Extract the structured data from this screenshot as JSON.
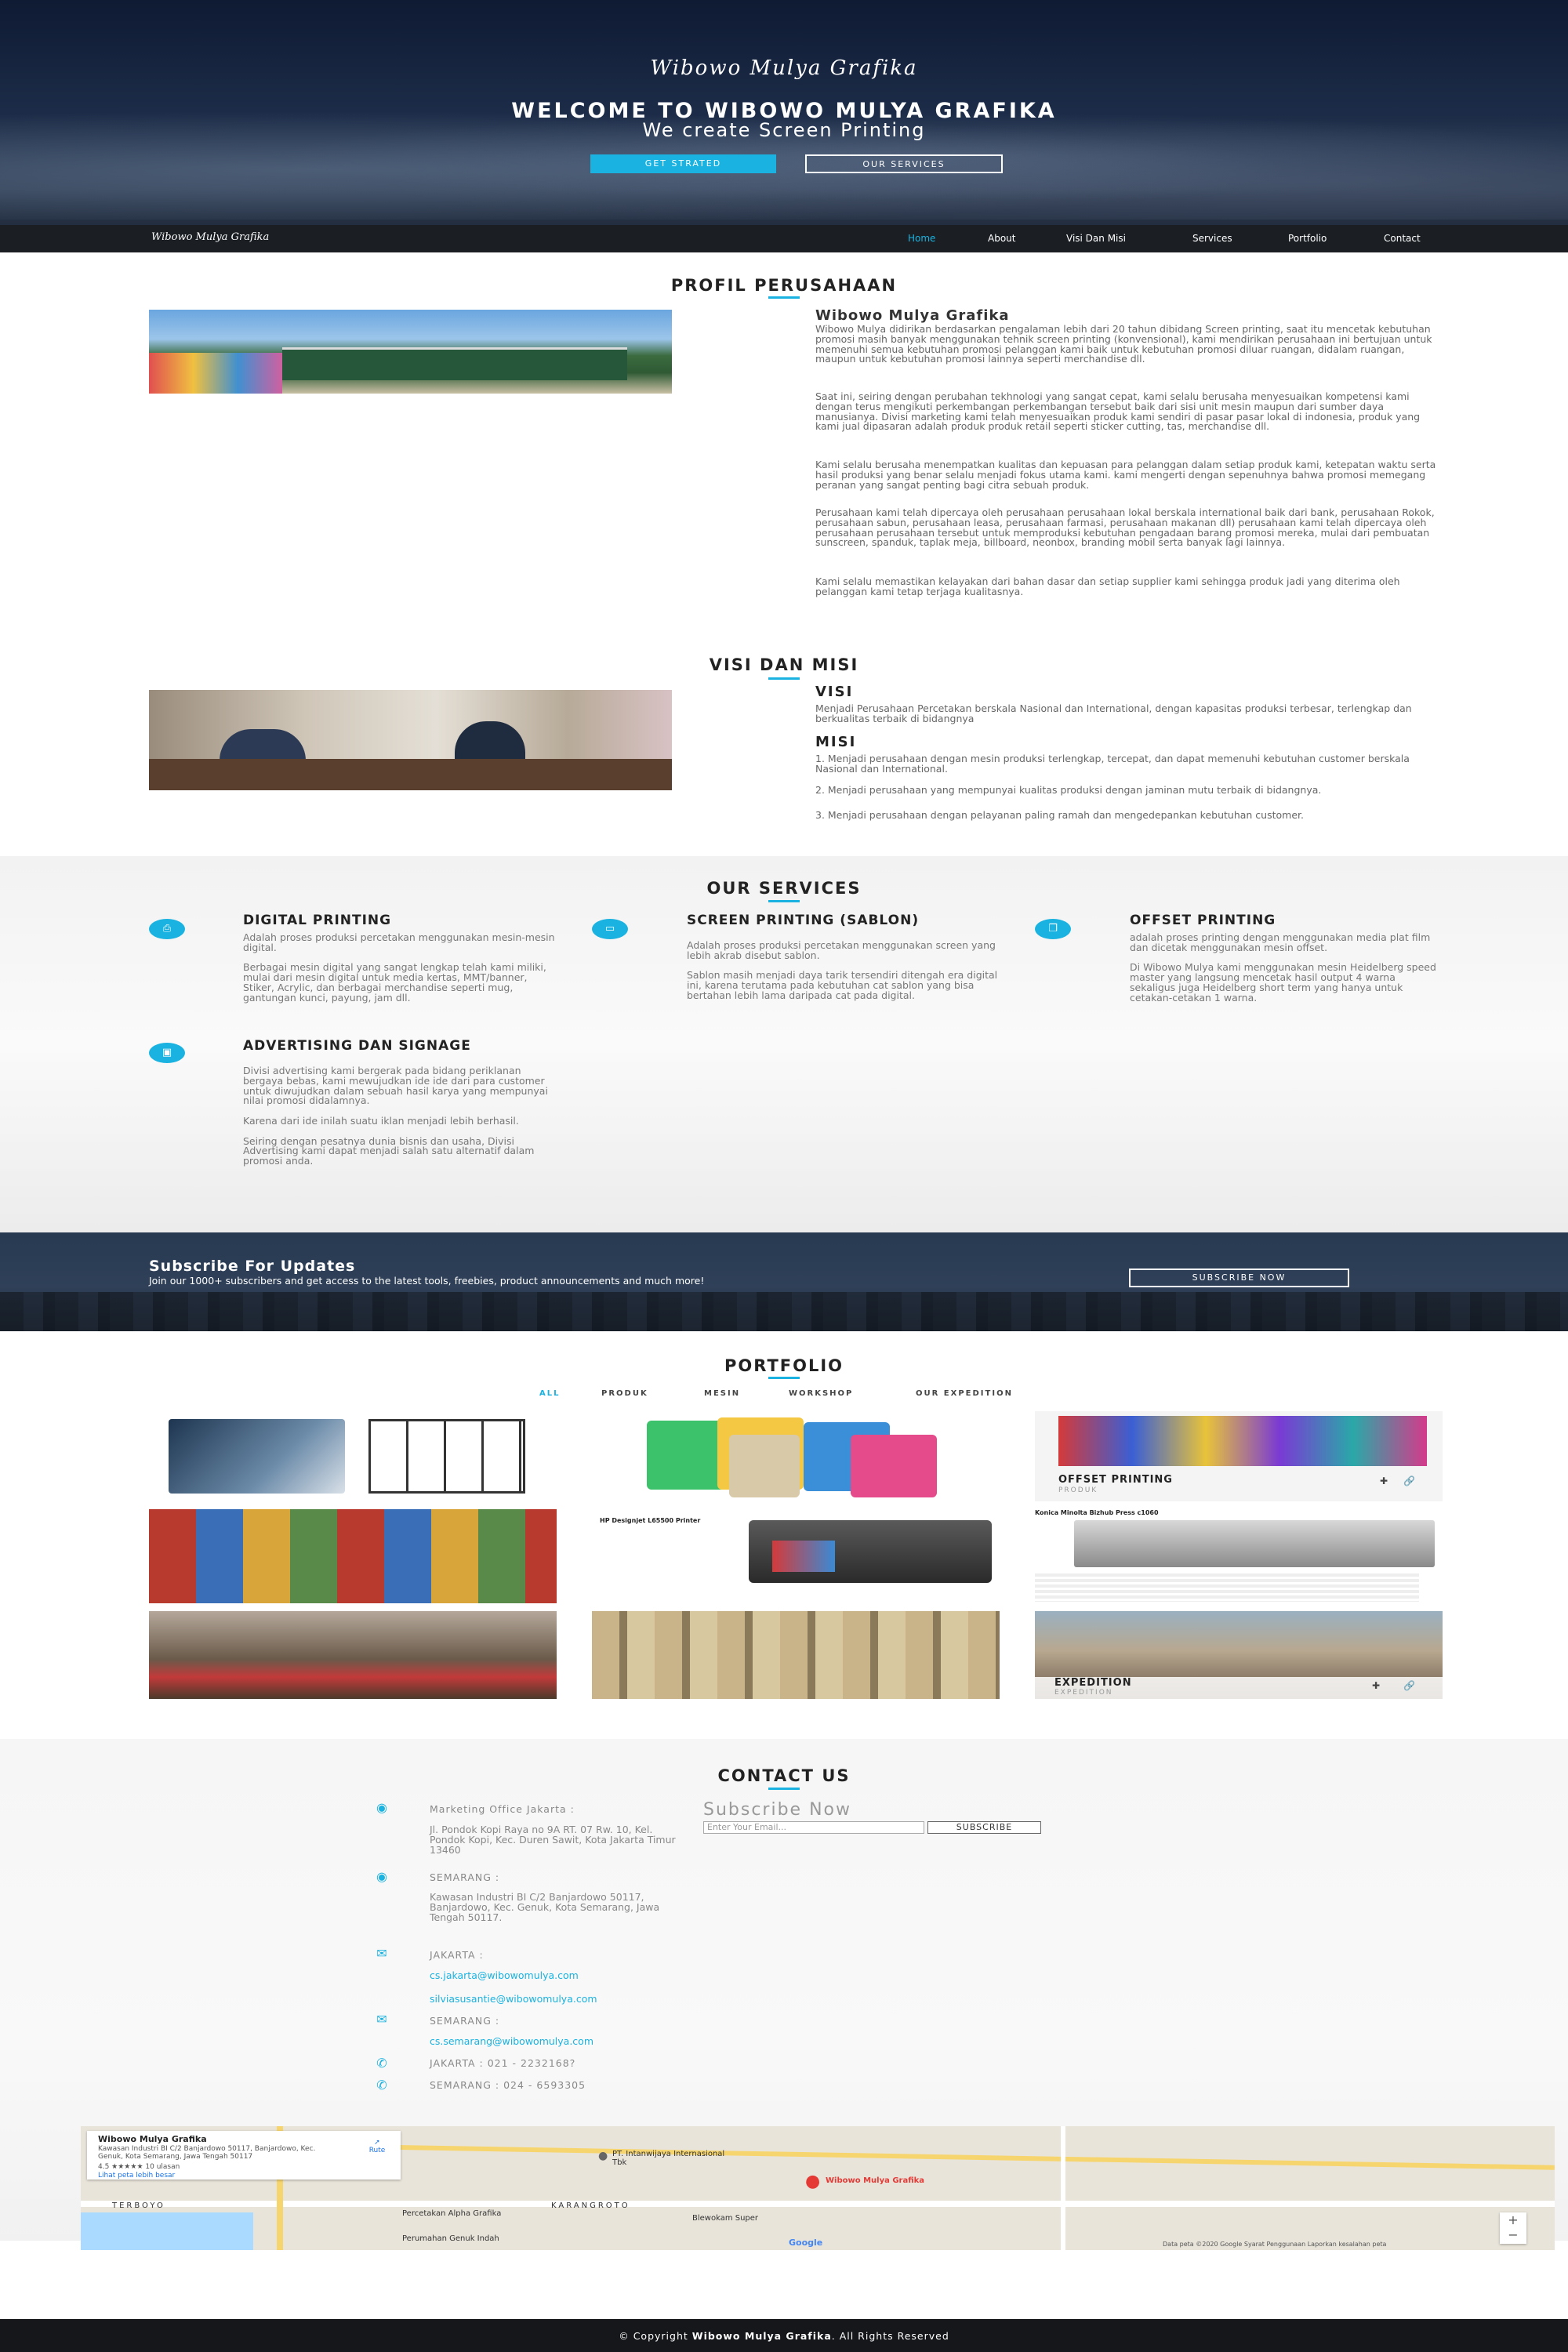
{
  "hero": {
    "script_title": "Wibowo Mulya Grafika",
    "title": "WELCOME TO WIBOWO MULYA GRAFIKA",
    "subtitle": "We create Screen Printing",
    "btn_start": "GET STRATED",
    "btn_services": "OUR SERVICES"
  },
  "nav": {
    "brand": "Wibowo Mulya Grafika",
    "items": [
      "Home",
      "About",
      "Visi Dan Misi",
      "Services",
      "Portfolio",
      "Contact"
    ]
  },
  "profile": {
    "title": "PROFIL PERUSAHAAN",
    "heading": "Wibowo Mulya Grafika",
    "paragraphs": [
      "Wibowo Mulya didirikan berdasarkan pengalaman lebih dari 20 tahun dibidang Screen printing, saat itu mencetak kebutuhan promosi masih banyak menggunakan tehnik screen printing (konvensional), kami mendirikan perusahaan ini bertujuan untuk memenuhi semua kebutuhan promosi pelanggan kami baik untuk kebutuhan promosi diluar ruangan, didalam ruangan, maupun untuk kebutuhan promosi lainnya seperti merchandise dll.",
      "Saat ini, seiring dengan perubahan tekhnologi yang sangat cepat, kami selalu berusaha menyesuaikan kompetensi kami dengan terus mengikuti perkembangan perkembangan tersebut baik dari sisi unit mesin maupun dari sumber daya manusianya. Divisi marketing kami telah menyesuaikan produk kami sendiri di pasar pasar lokal di indonesia, produk yang kami jual dipasaran adalah produk produk retail seperti sticker cutting, tas, merchandise dll.",
      "Kami selalu berusaha menempatkan kualitas dan kepuasan para pelanggan dalam setiap produk kami, ketepatan waktu serta hasil produksi yang benar selalu menjadi fokus utama kami. kami mengerti dengan sepenuhnya bahwa promosi memegang peranan yang sangat penting bagi citra sebuah produk.",
      "Perusahaan kami telah dipercaya oleh perusahaan perusahaan lokal berskala international baik dari bank, perusahaan Rokok, perusahaan sabun, perusahaan leasa, perusahaan farmasi, perusahaan makanan dll) perusahaan kami telah dipercaya oleh perusahaan perusahaan tersebut untuk memproduksi kebutuhan pengadaan barang promosi mereka, mulai dari pembuatan sunscreen, spanduk, taplak meja, billboard, neonbox, branding mobil serta banyak lagi lainnya.",
      "Kami selalu memastikan kelayakan dari bahan dasar dan setiap supplier kami sehingga produk jadi yang diterima oleh pelanggan kami tetap terjaga kualitasnya."
    ]
  },
  "visimisi": {
    "title": "VISI DAN MISI",
    "visi_head": "VISI",
    "visi_text": "Menjadi Perusahaan Percetakan berskala Nasional dan International, dengan kapasitas produksi terbesar, terlengkap dan berkualitas terbaik di bidangnya",
    "misi_head": "MISI",
    "misi": [
      "1. Menjadi perusahaan dengan mesin produksi terlengkap, tercepat, dan dapat memenuhi kebutuhan customer berskala Nasional dan International.",
      "2. Menjadi perusahaan yang mempunyai kualitas produksi dengan jaminan mutu terbaik di bidangnya.",
      "3. Menjadi perusahaan dengan pelayanan paling ramah dan mengedepankan kebutuhan customer."
    ]
  },
  "services": {
    "title": "OUR SERVICES",
    "items": [
      {
        "icon": "printer-icon",
        "glyph": "⎙",
        "title": "DIGITAL PRINTING",
        "text": "Adalah proses produksi percetakan menggunakan mesin-mesin digital.\n\nBerbagai mesin digital yang sangat lengkap telah kami miliki, mulai dari mesin digital untuk media kertas, MMT/banner, Stiker, Acrylic, dan berbagai merchandise seperti mug, gantungan kunci, payung, jam dll."
      },
      {
        "icon": "monitor-icon",
        "glyph": "▭",
        "title": "SCREEN PRINTING (SABLON)",
        "text": "Adalah proses produksi percetakan menggunakan screen yang lebih akrab disebut sablon.\n\nSablon masih menjadi daya tarik tersendiri ditengah era digital ini, karena terutama pada kebutuhan cat sablon yang bisa bertahan lebih lama daripada cat pada digital."
      },
      {
        "icon": "copy-icon",
        "glyph": "❐",
        "title": "OFFSET PRINTING",
        "text": "adalah proses printing dengan menggunakan media plat film dan dicetak menggunakan mesin offset.\n\nDi Wibowo Mulya kami menggunakan mesin Heidelberg speed master yang langsung mencetak hasil output 4 warna sekaligus juga Heidelberg short term yang hanya untuk cetakan-cetakan 1 warna."
      },
      {
        "icon": "billboard-icon",
        "glyph": "▣",
        "title": "ADVERTISING DAN SIGNAGE",
        "text": "Divisi advertising kami bergerak pada bidang periklanan bergaya bebas, kami mewujudkan ide ide dari para customer untuk diwujudkan dalam sebuah hasil karya yang mempunyai nilai promosi didalamnya.\n\nKarena dari ide inilah suatu iklan menjadi lebih berhasil.\n\nSeiring dengan pesatnya dunia bisnis dan usaha, Divisi Advertising kami dapat menjadi salah satu alternatif dalam promosi anda."
      }
    ]
  },
  "subscribe": {
    "title": "Subscribe For Updates",
    "text": "Join our 1000+ subscribers and get access to the latest tools, freebies, product announcements and much more!",
    "button": "SUBSCRIBE NOW"
  },
  "portfolio": {
    "title": "PORTFOLIO",
    "filters": [
      "ALL",
      "PRODUK",
      "MESIN",
      "WORKSHOP",
      "OUR EXPEDITION"
    ],
    "captions": {
      "offset_title": "OFFSET PRINTING",
      "offset_sub": "PRODUK",
      "expedition_title": "EXPEDITION",
      "expedition_sub": "EXPEDITION",
      "hp_title": "HP Designjet L65500 Printer",
      "konica_title": "Konica Minolta Bizhub Press c1060"
    }
  },
  "contact": {
    "title": "CONTACT US",
    "office_jkt_label": "Marketing Office Jakarta :",
    "office_jkt_addr": "Jl. Pondok Kopi Raya no 9A RT. 07 Rw. 10, Kel. Pondok Kopi, Kec. Duren Sawit, Kota Jakarta Timur 13460",
    "smg_label": "SEMARANG :",
    "smg_addr": "Kawasan Industri BI C/2 Banjardowo 50117, Banjardowo, Kec. Genuk, Kota Semarang, Jawa Tengah 50117.",
    "email_jkt_label": "JAKARTA :",
    "email_jkt_1": "cs.jakarta@wibowomulya.com",
    "email_jkt_2": "silviasusantie@wibowomulya.com",
    "email_smg_label": "SEMARANG :",
    "email_smg": "cs.semarang@wibowomulya.com",
    "phone_jkt": "JAKARTA : 021 - 2232168?",
    "phone_smg": "SEMARANG : 024 - 6593305",
    "subscribe_title": "Subscribe Now",
    "subscribe_placeholder": "Enter Your Email...",
    "subscribe_button": "SUBSCRIBE"
  },
  "map": {
    "card_title": "Wibowo Mulya Grafika",
    "card_addr": "Kawasan Industri BI C/2 Banjardowo 50117, Banjardowo, Kec. Genuk, Kota Semarang, Jawa Tengah 50117",
    "card_rating": "4.5 ★★★★★ 10 ulasan",
    "card_link": "Lihat peta lebih besar",
    "card_route": "Rute",
    "marker_label": "Wibowo Mulya Grafika",
    "labels": [
      "PT. Intanwijaya Internasional Tbk",
      "Percetakan Alpha Grafika",
      "Blewokam Super",
      "Perumahan Genuk Indah",
      "TERBOYO",
      "KARANGROTO"
    ],
    "footer": "Data peta ©2020 Google   Syarat Penggunaan   Laporkan kesalahan peta",
    "google": "Google"
  },
  "footer": {
    "prefix": "© Copyright",
    "brand": "Wibowo Mulya Grafika",
    "suffix": ". All Rights Reserved"
  },
  "colors": {
    "accent": "#1ab2e0",
    "dark": "#1b1f24"
  }
}
